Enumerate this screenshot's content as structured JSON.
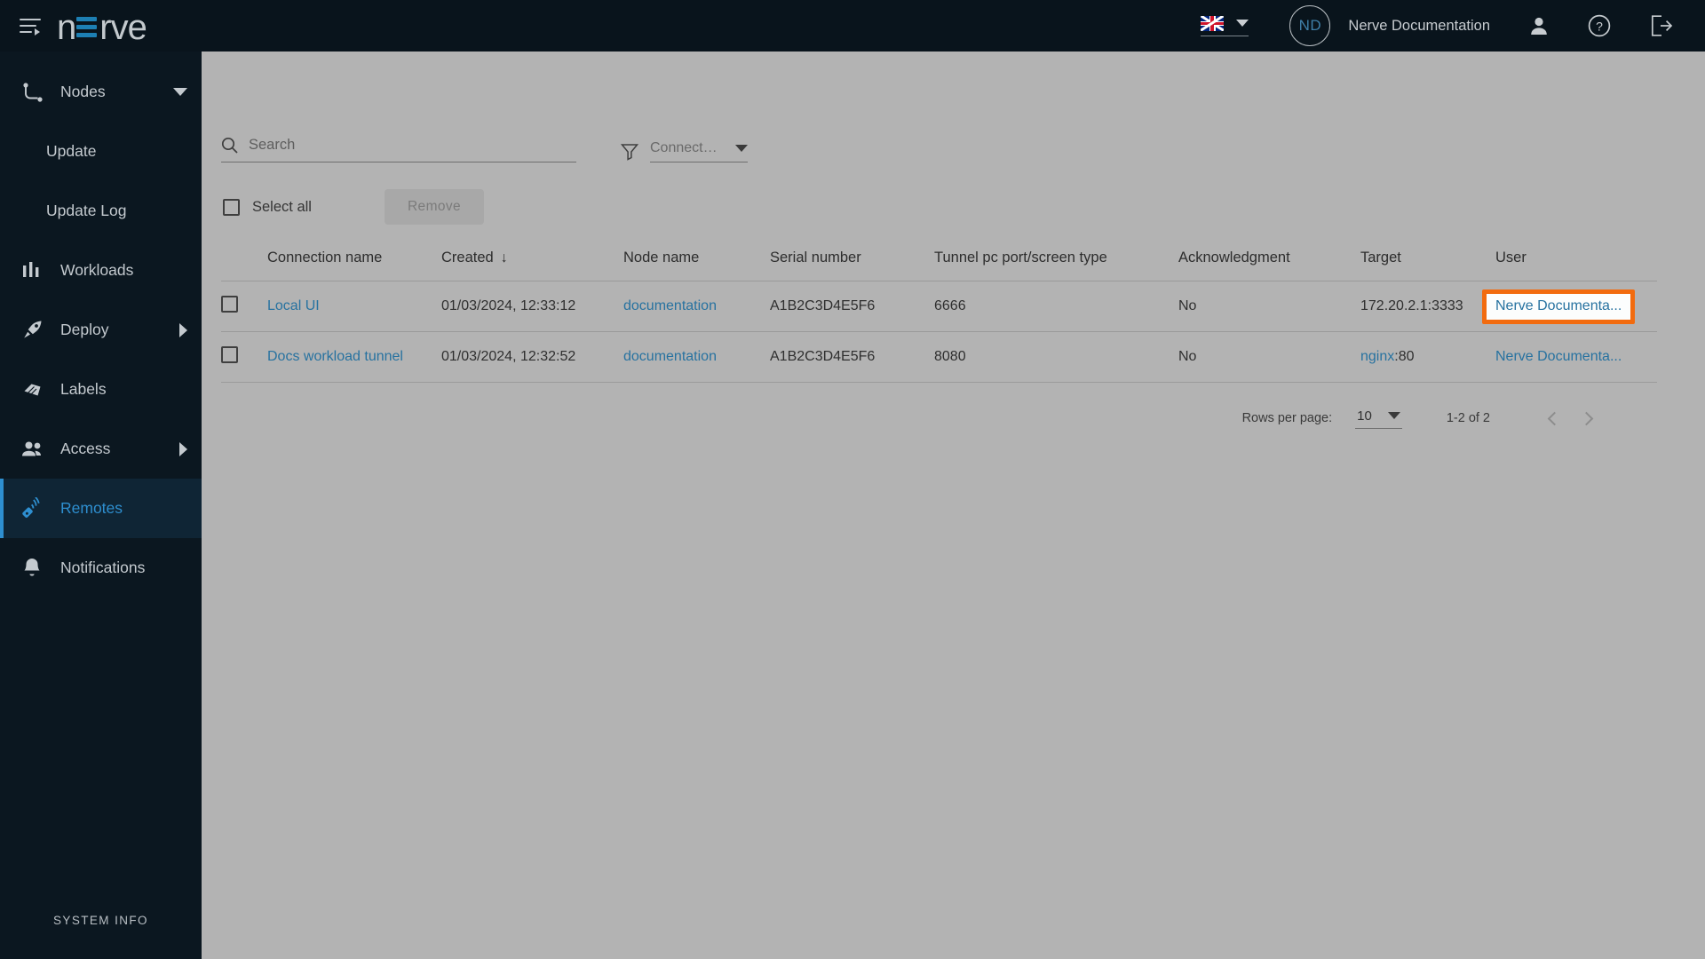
{
  "header": {
    "menu_icon": "hamburger-icon",
    "logo_text_left": "n",
    "logo_text_right": "rve",
    "language": "en-GB",
    "avatar_initials": "ND",
    "user_name": "Nerve Documentation",
    "profile_icon": "person-icon",
    "help_icon": "help-circle-icon",
    "logout_icon": "logout-icon"
  },
  "sidebar": {
    "items": [
      {
        "label": "Nodes",
        "icon": "nodes-icon",
        "expandable": "down",
        "active": false,
        "sub": false
      },
      {
        "label": "Update",
        "icon": "",
        "expandable": "",
        "active": false,
        "sub": true
      },
      {
        "label": "Update Log",
        "icon": "",
        "expandable": "",
        "active": false,
        "sub": true
      },
      {
        "label": "Workloads",
        "icon": "bars-icon",
        "expandable": "",
        "active": false,
        "sub": false
      },
      {
        "label": "Deploy",
        "icon": "rocket-icon",
        "expandable": "right",
        "active": false,
        "sub": false
      },
      {
        "label": "Labels",
        "icon": "tag-icon",
        "expandable": "",
        "active": false,
        "sub": false
      },
      {
        "label": "Access",
        "icon": "users-icon",
        "expandable": "right",
        "active": false,
        "sub": false
      },
      {
        "label": "Remotes",
        "icon": "remote-icon",
        "expandable": "",
        "active": true,
        "sub": false
      },
      {
        "label": "Notifications",
        "icon": "bell-icon",
        "expandable": "",
        "active": false,
        "sub": false
      }
    ],
    "system_info": "SYSTEM INFO"
  },
  "toolbar": {
    "search_placeholder": "Search",
    "search_value": "",
    "search_icon": "search-icon",
    "filter_icon": "filter-icon",
    "filter_label": "Connection",
    "select_all_label": "Select all",
    "select_all_checked": false,
    "remove_label": "Remove",
    "remove_disabled": true
  },
  "table": {
    "columns": [
      "Connection name",
      "Created",
      "Node name",
      "Serial number",
      "Tunnel pc port/screen type",
      "Acknowledgment",
      "Target",
      "User"
    ],
    "sorted_by": "Created",
    "sort_direction": "desc",
    "sort_glyph": "↓",
    "rows": [
      {
        "checked": false,
        "connection_name": "Local UI",
        "created": "01/03/2024, 12:33:12",
        "node_name": "documentation",
        "serial_number": "A1B2C3D4E5F6",
        "tunnel_port": "6666",
        "acknowledgment": "No",
        "target_link": "",
        "target_text": "172.20.2.1:3333",
        "user": "Nerve Documenta...",
        "user_highlighted": true
      },
      {
        "checked": false,
        "connection_name": "Docs workload tunnel",
        "created": "01/03/2024, 12:32:52",
        "node_name": "documentation",
        "serial_number": "A1B2C3D4E5F6",
        "tunnel_port": "8080",
        "acknowledgment": "No",
        "target_link": "nginx",
        "target_text": ":80",
        "user": "Nerve Documenta...",
        "user_highlighted": false
      }
    ]
  },
  "pagination": {
    "rows_per_page_label": "Rows per page:",
    "rows_per_page_value": "10",
    "range_label": "1-2 of 2",
    "prev_icon": "chevron-left-icon",
    "next_icon": "chevron-right-icon"
  },
  "colors": {
    "header_bg": "#09141c",
    "sidebar_bg": "#0b1720",
    "accent_blue": "#2e8fd0",
    "link_blue": "#2772a0",
    "page_bg": "#b3b3b3",
    "highlight_orange": "#f26b0f"
  }
}
